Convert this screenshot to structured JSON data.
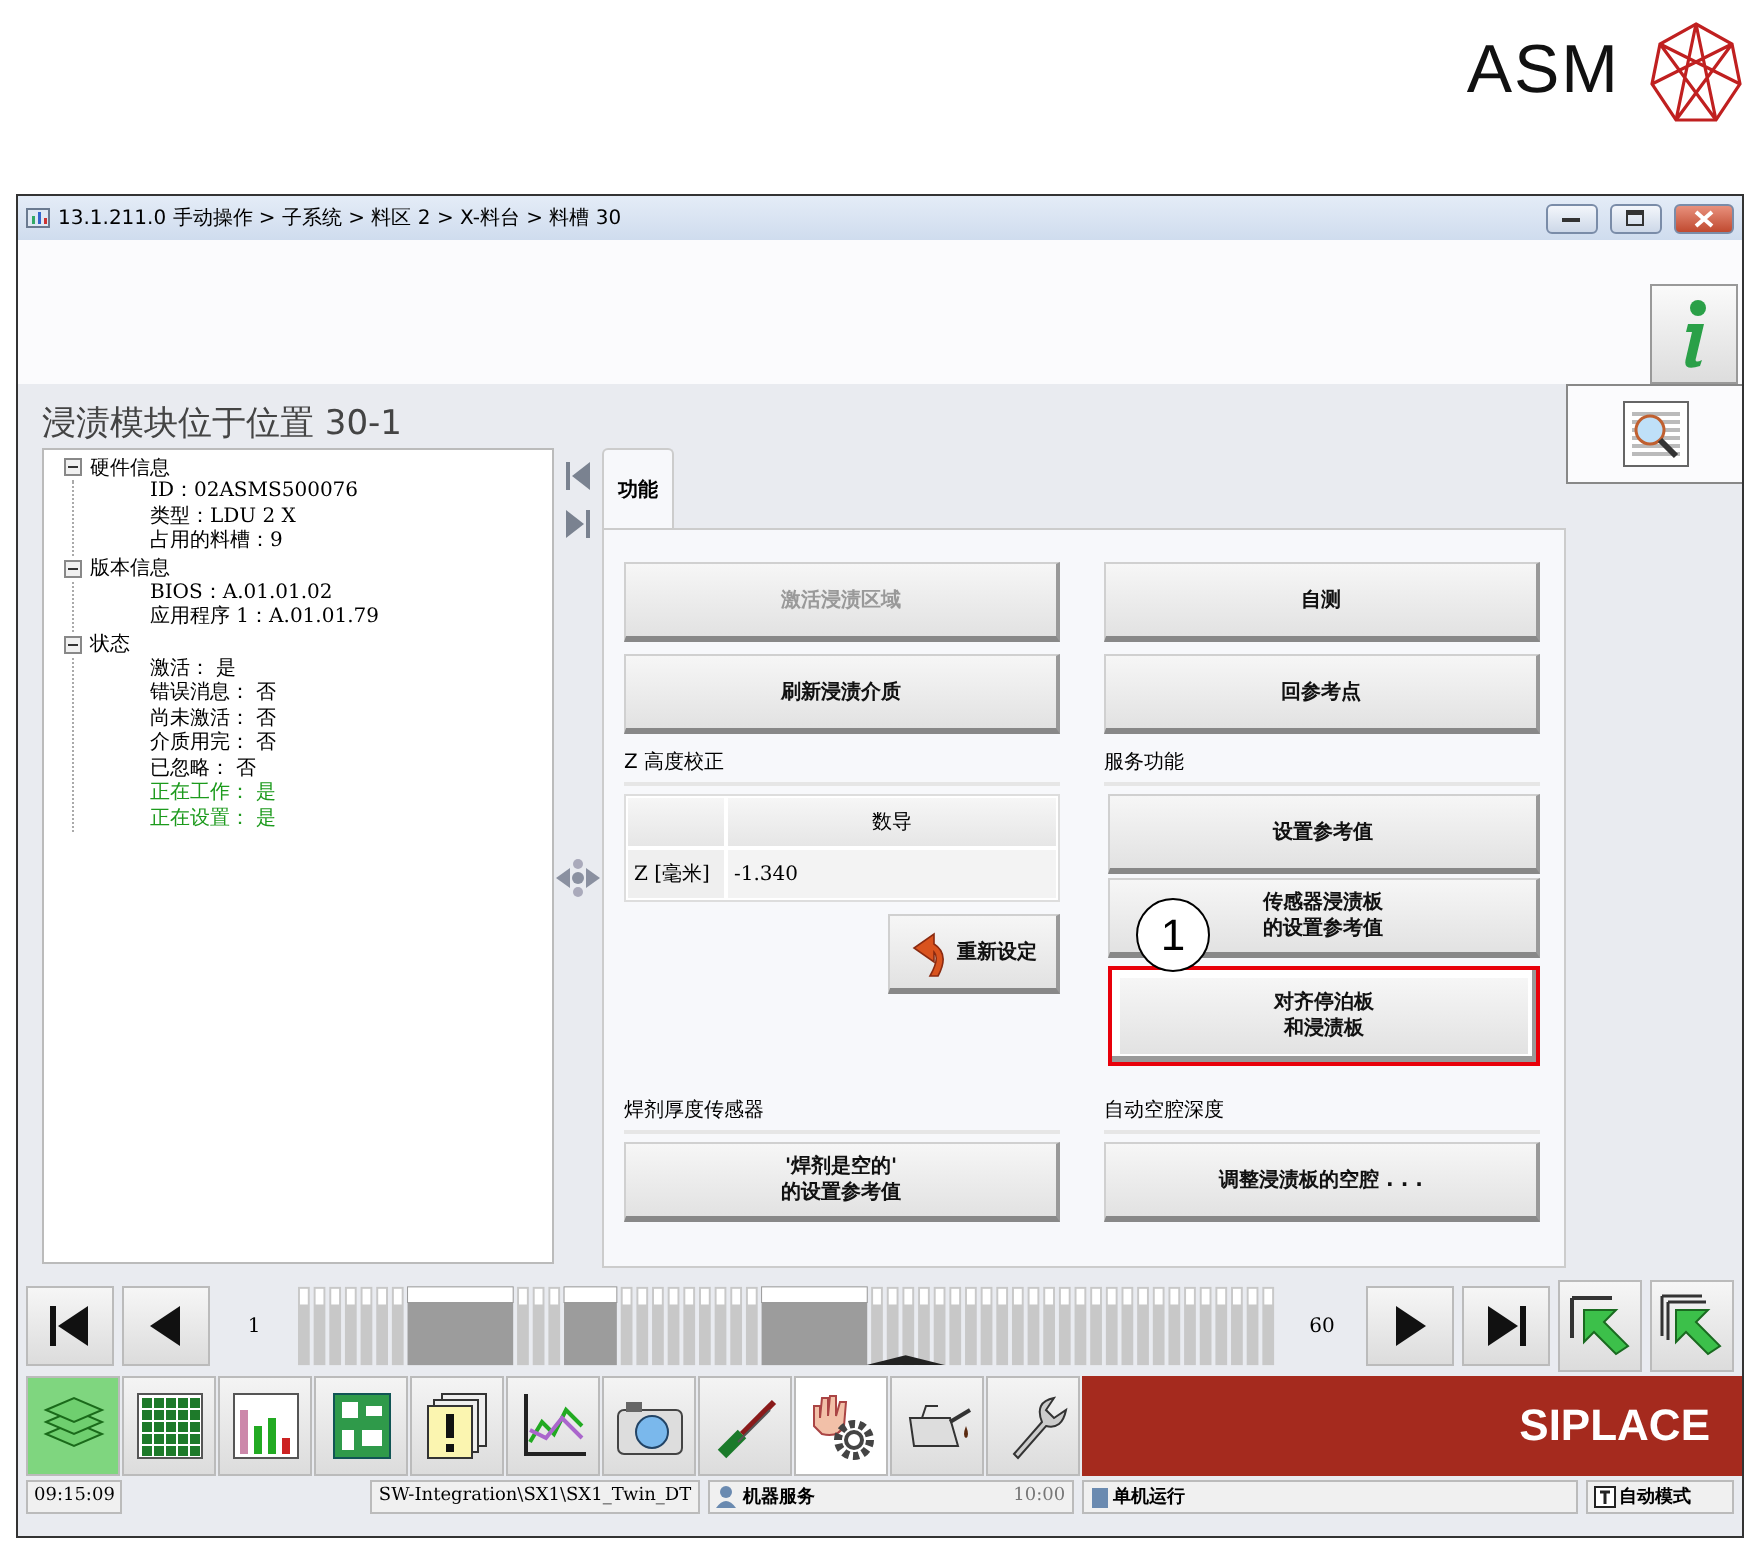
{
  "logo": {
    "text": "ASM"
  },
  "window": {
    "title": "13.1.211.0 手动操作 > 子系统 > 料区 2 > X-料台 > 料槽 30"
  },
  "heading": "浸渍模块位于位置 30-1",
  "tree": [
    {
      "label": "硬件信息",
      "expanded": true,
      "children": [
        {
          "label": "ID：02ASMS500076",
          "color": "#000000"
        },
        {
          "label": "类型：LDU 2 X",
          "color": "#000000"
        },
        {
          "label": "占用的料槽：9",
          "color": "#000000"
        }
      ]
    },
    {
      "label": "版本信息",
      "expanded": true,
      "children": [
        {
          "label": "BIOS：A.01.01.02",
          "color": "#000000"
        },
        {
          "label": "应用程序 1：A.01.01.79",
          "color": "#000000"
        }
      ]
    },
    {
      "label": "状态",
      "expanded": true,
      "children": [
        {
          "label": "激活： 是",
          "color": "#000000"
        },
        {
          "label": "错误消息： 否",
          "color": "#000000"
        },
        {
          "label": "尚未激活： 否",
          "color": "#000000"
        },
        {
          "label": "介质用完： 否",
          "color": "#000000"
        },
        {
          "label": "已忽略： 否",
          "color": "#000000"
        },
        {
          "label": "正在工作： 是",
          "color": "#1c9a1c"
        },
        {
          "label": "正在设置： 是",
          "color": "#1c9a1c"
        }
      ]
    }
  ],
  "tabs": [
    {
      "label": "功能",
      "selected": true
    }
  ],
  "function_buttons": [
    {
      "label": "激活浸渍区域",
      "disabled": true
    },
    {
      "label": "自测",
      "disabled": false
    },
    {
      "label": "刷新浸渍介质",
      "disabled": false
    },
    {
      "label": "回参考点",
      "disabled": false
    }
  ],
  "z_calibration": {
    "title": "Z 高度校正",
    "column_header": "数导",
    "row_label": "Z [毫米]",
    "value": "-1.340",
    "reset_button": "重新设定"
  },
  "service": {
    "title": "服务功能",
    "callout": "1",
    "buttons": [
      {
        "label": "设置参考值",
        "highlighted": false
      },
      {
        "label": "传感器浸渍板的设置参考值",
        "highlighted": false
      },
      {
        "label": "对齐停泊板和浸渍板",
        "highlighted": true
      }
    ]
  },
  "flux_sensor": {
    "title": "焊剂厚度传感器",
    "button": "'焊剂是空的'\n的设置参考值"
  },
  "cavity_depth": {
    "title": "自动空腔深度",
    "button": "调整浸渍板的空腔 . . ."
  },
  "side_tabs": [
    {
      "kind": "inspect",
      "selected": true
    }
  ],
  "slot_nav": {
    "first": "1",
    "last": "60"
  },
  "toolbar": [
    {
      "kind": "stack",
      "selected": true
    },
    {
      "kind": "grid",
      "selected": false
    },
    {
      "kind": "levels",
      "selected": false
    },
    {
      "kind": "board",
      "selected": false
    },
    {
      "kind": "pages",
      "selected": false
    },
    {
      "kind": "chart",
      "selected": false
    },
    {
      "kind": "camera",
      "selected": false
    },
    {
      "kind": "screwdriver",
      "selected": false
    },
    {
      "kind": "handgear",
      "selected": true
    },
    {
      "kind": "oilcan",
      "selected": false
    },
    {
      "kind": "wrench",
      "selected": false
    }
  ],
  "brand": "SIPLACE",
  "status_bar": {
    "time": "09:15:09",
    "path": "SW-Integration\\SX1\\SX1_Twin_DT",
    "role": "机器服务",
    "role_time": "10:00",
    "operation": "单机运行",
    "mode": "自动模式"
  }
}
